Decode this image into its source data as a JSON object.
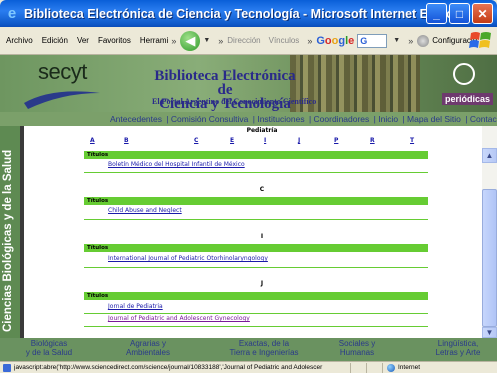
{
  "window": {
    "title": "Biblioteca Electrónica de Ciencia y Tecnología - Microsoft Internet Explorer",
    "minimize": "_",
    "maximize": "□",
    "close": "✕"
  },
  "toolbar": {
    "menus": [
      "Archivo",
      "Edición",
      "Ver",
      "Favoritos",
      "Herrami"
    ],
    "address_label": "Dirección",
    "links_label": "Vínculos",
    "google_brand": [
      "G",
      "o",
      "o",
      "g",
      "l",
      "e"
    ],
    "google_box": "G",
    "config_label": "Configuració"
  },
  "banner": {
    "logo_text": "secyt",
    "title_line1": "Biblioteca Electrónica de",
    "title_line2": "Ciencia y Tecnología",
    "subtitle": "El Portal Argentino del Conocimiento Científico",
    "badge": "periódicas"
  },
  "nav": {
    "links": [
      "Antecedentes",
      "Comisión Consultiva",
      "Instituciones",
      "Coordinadores",
      "Inicio",
      "Mapa del Sitio",
      "Contac"
    ]
  },
  "side_label": "Ciencias Biológicas y de la Salud",
  "main": {
    "heading": "Pediatría",
    "letters": [
      "A",
      "B",
      "C",
      "E",
      "I",
      "J",
      "P",
      "R",
      "T"
    ],
    "sections": [
      {
        "letter": "",
        "header": "Títulos",
        "journals": [
          "Boletín Médico del Hospital Infantil de México"
        ]
      },
      {
        "letter": "C",
        "header": "Títulos",
        "journals": [
          "Child Abuse and Neglect"
        ]
      },
      {
        "letter": "I",
        "header": "Títulos",
        "journals": [
          "International Journal of Pediatric Otorhinolaryngology"
        ]
      },
      {
        "letter": "J",
        "header": "Títulos",
        "journals": [
          "Jornal de Pediatria",
          "Journal of Pediatric and Adolescent Gynecology"
        ]
      }
    ]
  },
  "categories": [
    {
      "line1": "Biológicas",
      "line2": "y de la Salud"
    },
    {
      "line1": "Agrarias y",
      "line2": "Ambientales"
    },
    {
      "line1": "Exactas, de la",
      "line2": "Tierra e Ingenierías"
    },
    {
      "line1": "Sociales y",
      "line2": "Humanas"
    },
    {
      "line1": "Lingüística,",
      "line2": "Letras y Arte"
    }
  ],
  "status": {
    "text": "javascript:abre('http://www.sciencedirect.com/science/journal/10833188','Journal of Pediatric and Adolescer",
    "zone": "Internet"
  }
}
